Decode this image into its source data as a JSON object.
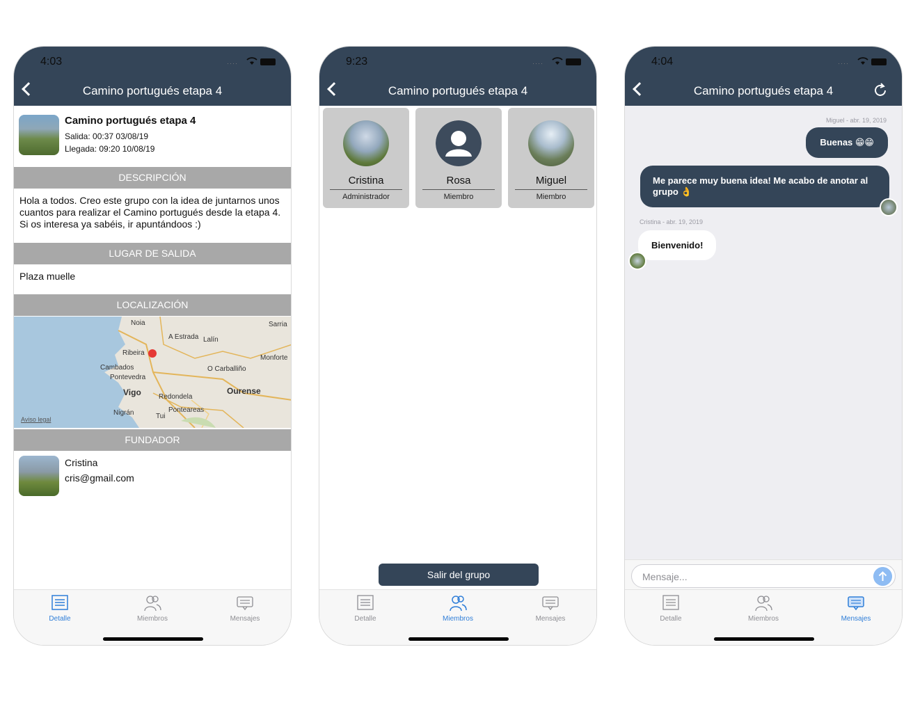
{
  "colors": {
    "nav": "#344558",
    "accent": "#2f7ed8",
    "section": "#a8a8a8"
  },
  "screens": [
    {
      "time": "4:03",
      "title": "Camino portugués etapa 4",
      "header": {
        "name": "Camino portugués etapa 4",
        "salida": "Salida:  00:37 03/08/19",
        "llegada": "Llegada: 09:20 10/08/19"
      },
      "sections": {
        "descripcion": "DESCRIPCIÓN",
        "lugar": "LUGAR DE SALIDA",
        "localizacion": "LOCALIZACIÓN",
        "fundador": "FUNDADOR"
      },
      "descripcion_text": "Hola a todos. Creo este grupo con la idea de juntarnos unos cuantos para realizar el Camino portugués desde la etapa 4. Si os interesa ya sabéis, ir apuntándoos :)",
      "lugar_text": "Plaza muelle",
      "map_labels": {
        "noia": "Noia",
        "sarria": "Sarria",
        "estrada": "A Estrada",
        "lalin": "Lalín",
        "ribeira": "Ribeira",
        "monforte": "Monforte",
        "cambados": "Cambados",
        "carballino": "O Carballiño",
        "pontevedra": "Pontevedra",
        "ourense": "Ourense",
        "vigo": "Vigo",
        "redondela": "Redondela",
        "nigran": "Nigrán",
        "ponteareas": "Ponteareas",
        "tui": "Tui",
        "aviso": "Aviso legal"
      },
      "fundador": {
        "name": "Cristina",
        "email": "cris@gmail.com"
      }
    },
    {
      "time": "9:23",
      "title": "Camino portugués etapa 4",
      "members": [
        {
          "name": "Cristina",
          "role": "Administrador"
        },
        {
          "name": "Rosa",
          "role": "Miembro"
        },
        {
          "name": "Miguel",
          "role": "Miembro"
        }
      ],
      "leave_label": "Salir del grupo"
    },
    {
      "time": "4:04",
      "title": "Camino portugués etapa 4",
      "messages": [
        {
          "meta": "Miguel  -  abr. 19, 2019",
          "text": "Buenas 😁😁"
        },
        {
          "text": "Me parece muy buena idea! Me acabo de anotar al grupo 👌"
        },
        {
          "meta": "Cristina  -  abr. 19, 2019",
          "text": "Bienvenido!"
        }
      ],
      "input_placeholder": "Mensaje..."
    }
  ],
  "tabs": [
    {
      "label": "Detalle",
      "icon": "list-icon"
    },
    {
      "label": "Miembros",
      "icon": "people-icon"
    },
    {
      "label": "Mensajes",
      "icon": "chat-icon"
    }
  ]
}
